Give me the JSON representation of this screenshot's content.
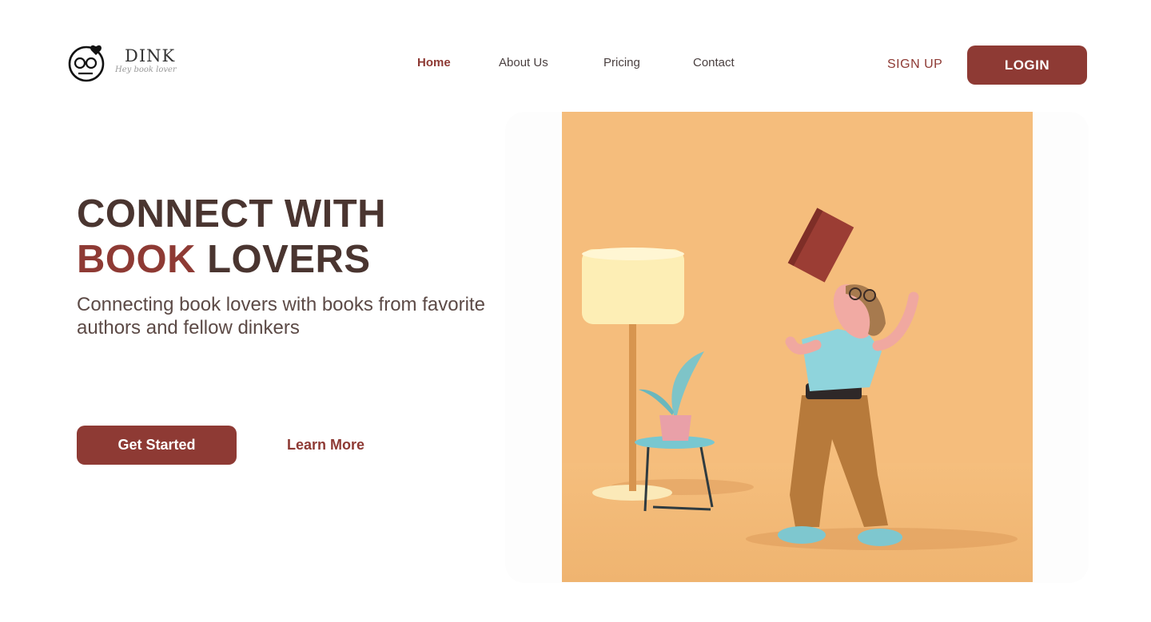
{
  "brand": {
    "name": "DINK",
    "tagline": "Hey book lover"
  },
  "nav": {
    "items": [
      "Home",
      "About Us",
      "Pricing",
      "Contact"
    ],
    "active": "Home"
  },
  "auth": {
    "signup_label": "SIGN UP",
    "login_label": "LOGIN"
  },
  "hero": {
    "headline_line1": "CONNECT WITH",
    "headline_accent": "BOOK",
    "headline_rest": " LOVERS",
    "subtitle": "Connecting book lovers with books from favorite authors and fellow dinkers",
    "primary_cta": "Get Started",
    "secondary_cta": "Learn More"
  },
  "colors": {
    "accent": "#8e3a34",
    "heading": "#4a3530",
    "illustration_bg": "#f5bd7c"
  },
  "icons": [
    "logo-face-icon",
    "heart-icon"
  ]
}
